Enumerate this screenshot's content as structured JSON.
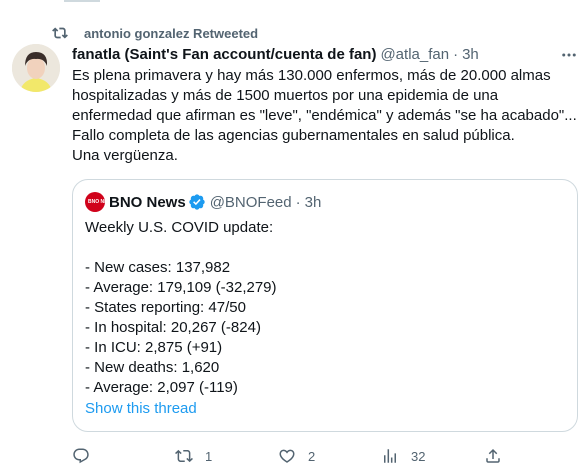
{
  "retweet": {
    "text": "antonio gonzalez Retweeted"
  },
  "tweet": {
    "name": "fanatla (Saint's Fan account/cuenta de fan)",
    "handle": "@atla_fan",
    "dot": "·",
    "time": "3h",
    "text": "Es plena primavera y hay más 130.000 enfermos, más de 20.000 almas\nhospitalizadas y más de 1500 muertos por una epidemia de una\nenfermedad que afirman es \"leve\", \"endémica\" y además \"se ha acabado\"...\nFallo completa de las agencias gubernamentales en salud pública.\nUna vergüenza."
  },
  "quote": {
    "avatar_text": "BNO NEWS",
    "name": "BNO News",
    "handle": "@BNOFeed",
    "dot": "·",
    "time": "3h",
    "text": "Weekly U.S. COVID update:\n\n- New cases: 137,982\n- Average: 179,109 (-32,279)\n- States reporting: 47/50\n- In hospital: 20,267 (-824)\n- In ICU: 2,875 (+91)\n- New deaths: 1,620\n- Average: 2,097 (-119)",
    "show_thread": "Show this thread"
  },
  "actions": {
    "reply_count": "",
    "retweet_count": "1",
    "like_count": "2",
    "views_count": "32"
  },
  "icons": {
    "retweet": "retweet-icon",
    "more": "more-icon",
    "verified": "verified-badge-icon",
    "reply": "reply-icon",
    "like": "heart-icon",
    "views": "views-icon",
    "share": "share-icon"
  },
  "colors": {
    "accent": "#1d9bf0",
    "muted": "#536471",
    "border": "#cfd9de",
    "bno_red": "#d0021b"
  }
}
